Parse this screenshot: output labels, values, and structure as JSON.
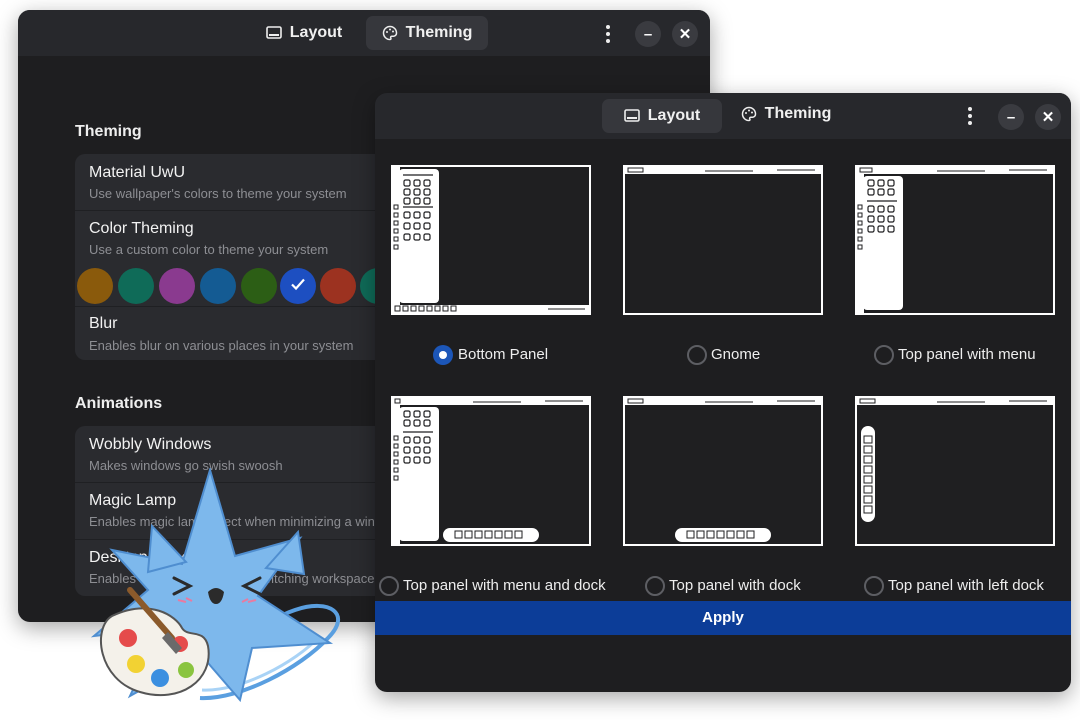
{
  "back_window": {
    "tabs": [
      {
        "label": "Layout",
        "icon": "monitor-icon",
        "active": false
      },
      {
        "label": "Theming",
        "icon": "palette-icon",
        "active": true
      }
    ],
    "theming_section_title": "Theming",
    "theming_rows": [
      {
        "title": "Material UwU",
        "subtitle": "Use wallpaper's colors to theme your system"
      },
      {
        "title": "Color Theming",
        "subtitle": "Use a custom color to theme your system"
      },
      {
        "title": "Blur",
        "subtitle": "Enables blur on various places in your system"
      }
    ],
    "swatches": [
      "#8a5a0c",
      "#0f6b58",
      "#8a3a8f",
      "#145b93",
      "#2c5e15",
      "#1d4fc1",
      "#9c3220",
      "#0f6b58"
    ],
    "selected_swatch": 5,
    "animations_section_title": "Animations",
    "animation_rows": [
      {
        "title": "Wobbly Windows",
        "subtitle": "Makes windows go swish swoosh"
      },
      {
        "title": "Magic Lamp",
        "subtitle": "Enables magic lamp effect when minimizing a window"
      },
      {
        "title": "Desktop Cube",
        "subtitle": "Enables desktop cube when switching workspaces"
      }
    ]
  },
  "front_window": {
    "tabs": [
      {
        "label": "Layout",
        "icon": "monitor-icon",
        "active": true
      },
      {
        "label": "Theming",
        "icon": "palette-icon",
        "active": false
      }
    ],
    "layouts": [
      {
        "label": "Bottom Panel",
        "selected": true
      },
      {
        "label": "Gnome",
        "selected": false
      },
      {
        "label": "Top panel with menu",
        "selected": false
      },
      {
        "label": "Top panel with menu and dock",
        "selected": false
      },
      {
        "label": "Top panel with dock",
        "selected": false
      },
      {
        "label": "Top panel with left dock",
        "selected": false
      }
    ],
    "apply_label": "Apply"
  },
  "mascot": {
    "name": "mascot-with-palette",
    "colors": {
      "body": "#7db8ec",
      "palette_red": "#e54b4b",
      "palette_yellow": "#f2d233",
      "palette_blue": "#3b8fe0",
      "palette_green": "#8ac43f"
    }
  }
}
